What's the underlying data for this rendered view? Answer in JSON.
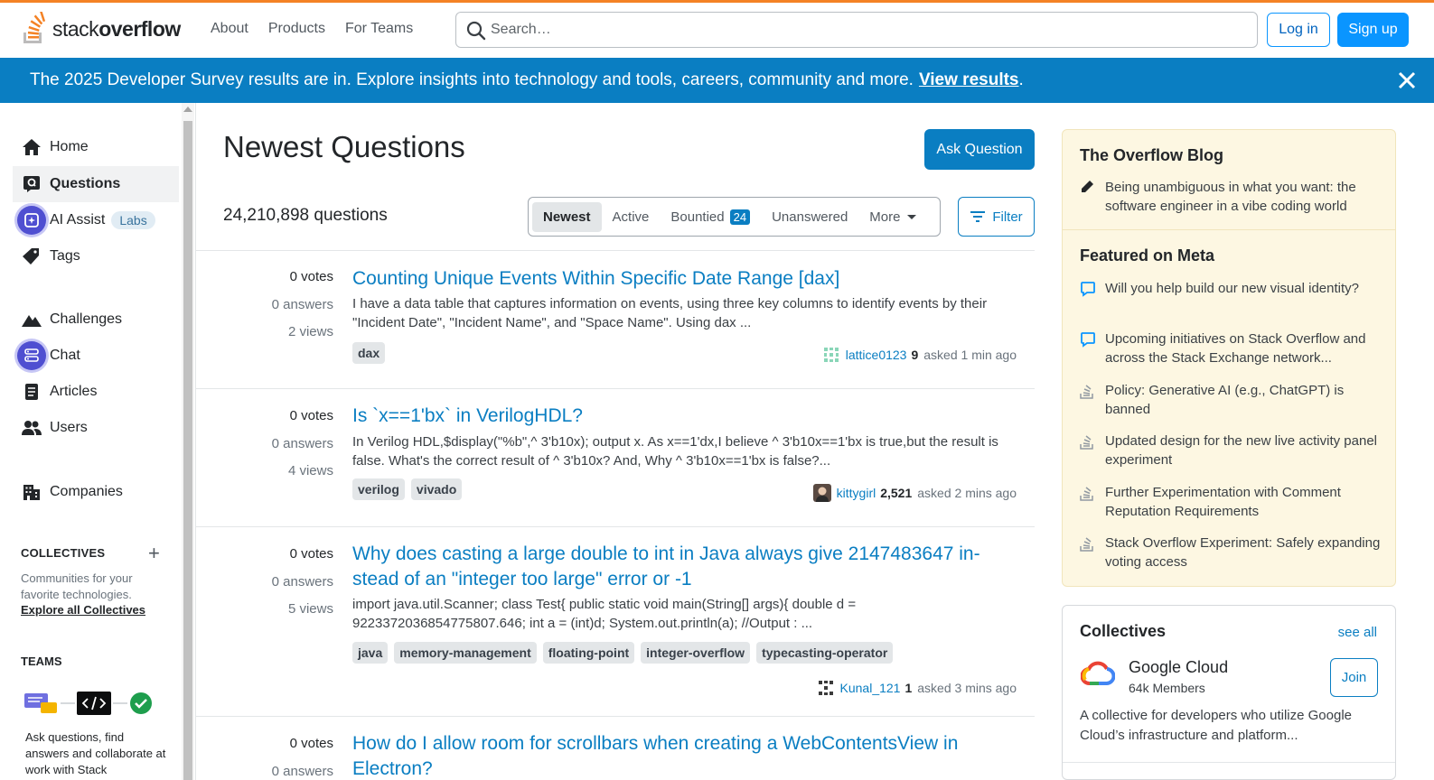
{
  "header": {
    "logo_text_light": "stack",
    "logo_text_bold": "overflow",
    "nav": [
      "About",
      "Products",
      "For Teams"
    ],
    "search_placeholder": "Search…",
    "login": "Log in",
    "signup": "Sign up"
  },
  "banner": {
    "text": "The 2025 Developer Survey results are in. Explore insights into technology and tools, careers, community and more.",
    "link": "View results",
    "after": "."
  },
  "sidebar": {
    "items": [
      {
        "label": "Home"
      },
      {
        "label": "Questions"
      },
      {
        "label": "AI Assist",
        "badge": "Labs"
      },
      {
        "label": "Tags"
      },
      {
        "label": "Challenges"
      },
      {
        "label": "Chat"
      },
      {
        "label": "Articles"
      },
      {
        "label": "Users"
      },
      {
        "label": "Companies"
      }
    ],
    "collectives_heading": "COLLECTIVES",
    "collectives_desc": "Communities for your favorite technologies.",
    "collectives_link": "Explore all Collectives",
    "teams_heading": "TEAMS",
    "teams_desc": "Ask questions, find answers and collaborate at work with Stack"
  },
  "main": {
    "title": "Newest Questions",
    "ask_button": "Ask Question",
    "count": "24,210,898 questions",
    "tabs": [
      "Newest",
      "Active",
      "Bountied",
      "Unanswered",
      "More"
    ],
    "bountied_count": "24",
    "filter": "Filter",
    "questions": [
      {
        "votes": "0 votes",
        "answers": "0 answers",
        "views": "2 views",
        "title": "Counting Unique Events Within Specific Date Range [dax]",
        "excerpt": "I have a data table that captures information on events, using three key columns to identify events by their \"Incident Date\", \"Incident Name\", and \"Space Name\". Using dax ...",
        "tags": [
          "dax"
        ],
        "user": "lattice0123",
        "rep": "9",
        "asked": "asked 1 min ago"
      },
      {
        "votes": "0 votes",
        "answers": "0 answers",
        "views": "4 views",
        "title": "Is `x==1'bx` in VerilogHDL?",
        "excerpt": "In Verilog HDL,$display(\"%b\",^ 3'b10x); output x. As x==1'dx,I believe ^ 3'b10x==1'bx is true,but the result is false. What's the correct result of ^ 3'b10x? And, Why ^ 3'b10x==1'bx is false?...",
        "tags": [
          "verilog",
          "vivado"
        ],
        "user": "kittygirl",
        "rep": "2,521",
        "asked": "asked 2 mins ago"
      },
      {
        "votes": "0 votes",
        "answers": "0 answers",
        "views": "5 views",
        "title": "Why does casting a large double to int in Java always give 2147483647 in­stead of an \"integer too large\" error or -1",
        "excerpt": "import java.util.Scanner; class Test{ public static void main(String[] args){ double d = 9223372036854775807.646; int a = (int)d; System.out.println(a); //Output : ...",
        "tags": [
          "java",
          "memory-management",
          "floating-point",
          "integer-overflow",
          "typecasting-operator"
        ],
        "user": "Kunal_121",
        "rep": "1",
        "asked": "asked 3 mins ago"
      },
      {
        "votes": "0 votes",
        "answers": "0 answers",
        "views": "",
        "title": "How do I allow room for scrollbars when creating a WebContentsView in Electron?",
        "excerpt": "",
        "tags": [],
        "user": "",
        "rep": "",
        "asked": ""
      }
    ]
  },
  "right": {
    "blog_heading": "The Overflow Blog",
    "blog_items": [
      "Being unambiguous in what you want: the software engineer in a vibe coding world"
    ],
    "meta_heading": "Featured on Meta",
    "meta_items": [
      "Will you help build our new visual identity?",
      "Upcoming initiatives on Stack Overflow and across the Stack Exchange network...",
      "Policy: Generative AI (e.g., ChatGPT) is banned",
      "Updated design for the new live activity panel experiment",
      "Further Experimentation with Comment Reputation Requirements",
      "Stack Overflow Experiment: Safely expanding voting access"
    ],
    "collectives_heading": "Collectives",
    "see_all": "see all",
    "collective": {
      "name": "Google Cloud",
      "members": "64k Members",
      "join": "Join",
      "desc": "A collective for developers who utilize Google Cloud’s infrastructure and platform..."
    }
  },
  "colors": {
    "accent": "#0a95ff",
    "link": "#0a7ec2",
    "banner": "#0a7ec2",
    "brand_orange": "#f48225",
    "blog_bg": "#fdf7e2"
  }
}
